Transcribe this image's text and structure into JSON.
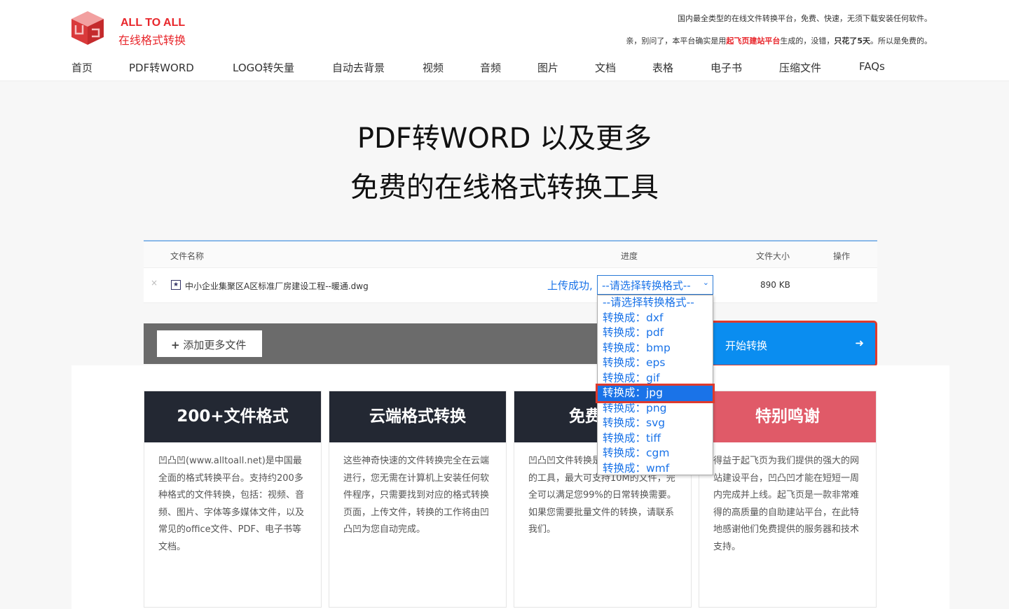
{
  "header": {
    "brand_en": "ALL TO ALL",
    "brand_cn": "在线格式转换",
    "slogan1": "国内最全类型的在线文件转换平台，免费、快速，无须下载安装任何软件。",
    "slogan2_a": "亲，别问了，本平台确实是用",
    "slogan2_link": "起飞页建站平台",
    "slogan2_b": "生成的，没错，",
    "slogan2_bold": "只花了5天",
    "slogan2_c": "。所以是免费的。"
  },
  "nav": [
    "首页",
    "PDF转WORD",
    "LOGO转矢量",
    "自动去背景",
    "视频",
    "音频",
    "图片",
    "文档",
    "表格",
    "电子书",
    "压缩文件",
    "FAQs"
  ],
  "hero": {
    "line1": "PDF转WORD 以及更多",
    "line2": "免费的在线格式转换工具"
  },
  "table": {
    "headers": {
      "name": "文件名称",
      "progress": "进度",
      "size": "文件大小",
      "action": "操作"
    },
    "row": {
      "remove": "×",
      "filename": "中小企业集聚区A区标准厂房建设工程--暖通.dwg",
      "status": "上传成功,",
      "select": "--请选择转换格式--",
      "size": "890 KB"
    }
  },
  "dropdown": {
    "options": [
      "--请选择转换格式--",
      "转换成：dxf",
      "转换成：pdf",
      "转换成：bmp",
      "转换成：eps",
      "转换成：gif",
      "转换成：jpg",
      "转换成：png",
      "转换成：svg",
      "转换成：tiff",
      "转换成：cgm",
      "转换成：wmf"
    ],
    "highlighted": 6
  },
  "actions": {
    "add": "添加更多文件",
    "start": "开始转换"
  },
  "cards": [
    {
      "title": "200+文件格式",
      "text": "凹凸凹(www.alltoall.net)是中国最全面的格式转换平台。支持约200多种格式的文件转换，包括：视频、音频、图片、字体等多媒体文件，以及常见的office文件、PDF、电子书等文档。"
    },
    {
      "title": "云端格式转换",
      "text": "这些神奇快速的文件转换完全在云端进行，您无需在计算机上安装任何软件程序，只需要找到对应的格式转换页面，上传文件，转换的工作将由凹凸凹为您自动完成。"
    },
    {
      "title": "免费",
      "text": "凹凸凹文件转换是一款可以免费便用的工具，最大可支持10M的文件，完全可以满足您99%的日常转换需要。如果您需要批量文件的转换，请联系我们。"
    },
    {
      "title": "特别鸣谢",
      "text": "得益于起飞页为我们提供的强大的网站建设平台，凹凸凹才能在短短一周内完成并上线。起飞页是一款非常难得的高质量的自助建站平台，在此特地感谢他们免费提供的服务器和技术支持。"
    }
  ],
  "colors": {
    "brand": "#e8262b",
    "accent": "#0a8df0",
    "card_header": "#232833",
    "thanks": "#e05a68"
  }
}
